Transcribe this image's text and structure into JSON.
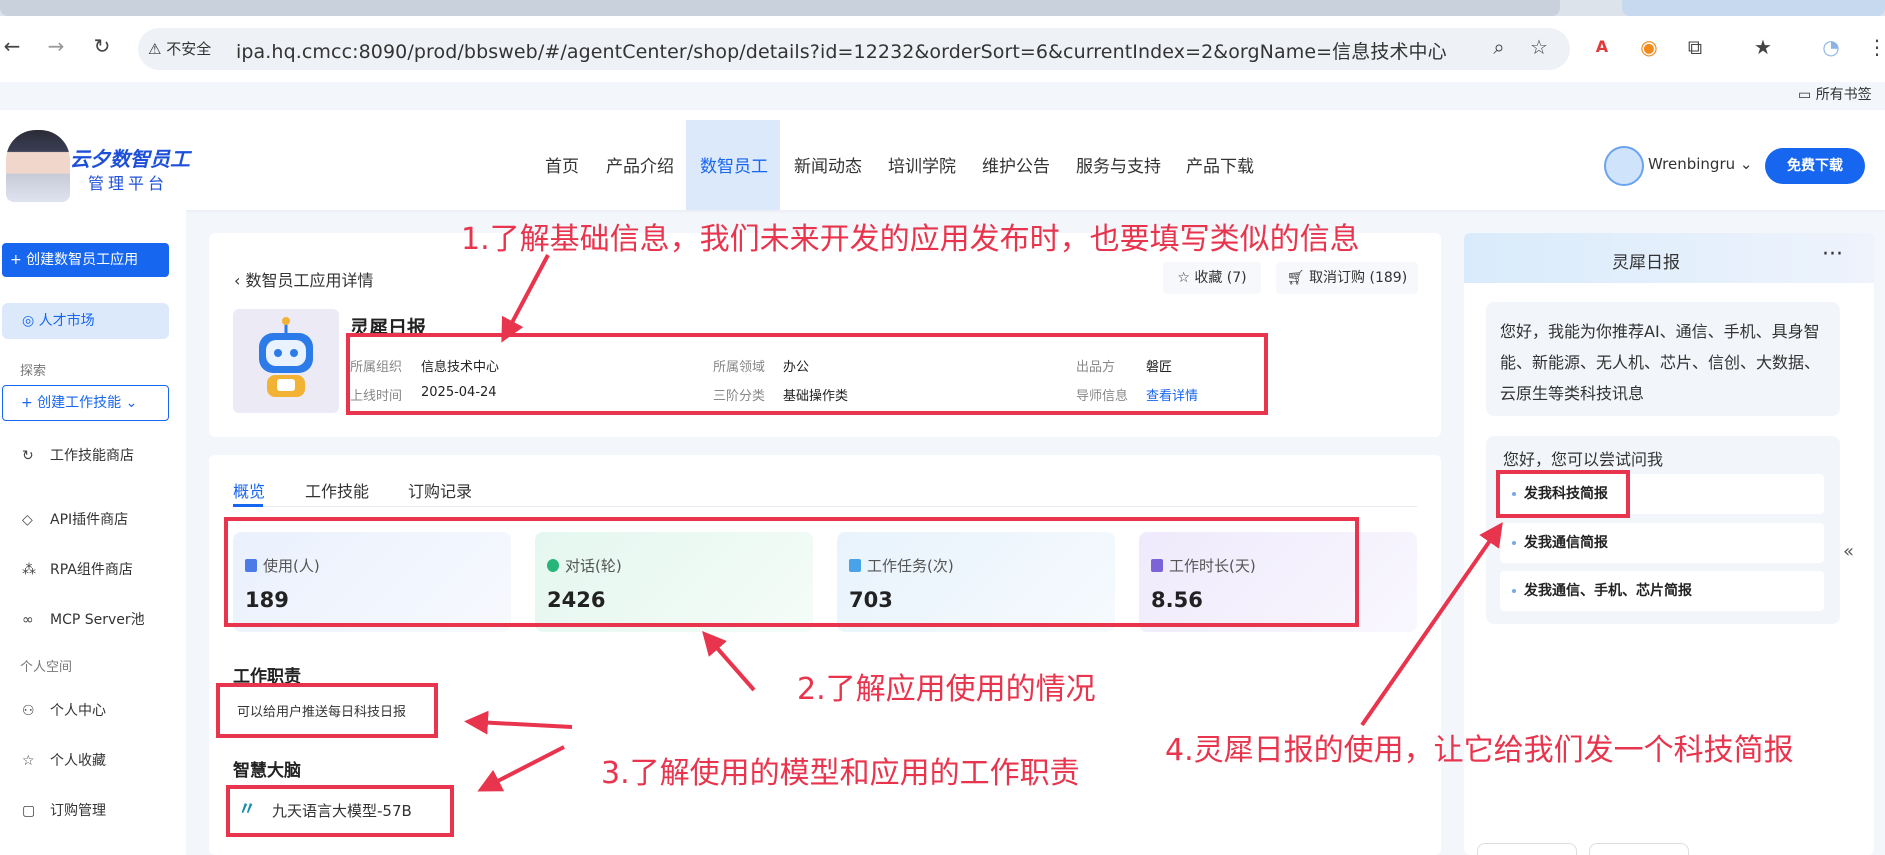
{
  "browser": {
    "insecure_label": "不安全",
    "url": "ipa.hq.cmcc:8090/prod/bbsweb/#/agentCenter/shop/details?id=12232&orderSort=6&currentIndex=2&orgName=信息技术中心",
    "bookmarks_label": "所有书签"
  },
  "brand": {
    "title": "云夕数智员工",
    "subtitle": "管理平台"
  },
  "nav": {
    "items": [
      "首页",
      "产品介绍",
      "数智员工",
      "新闻动态",
      "培训学院",
      "维护公告",
      "服务与支持",
      "产品下载"
    ],
    "active": "数智员工"
  },
  "user": {
    "name": "Wrenbingru",
    "download_label": "免费下载"
  },
  "sidebar": {
    "create_app": "+ 创建数智员工应用",
    "talent_market": "人才市场",
    "explore_label": "探索",
    "create_skill": "+ 创建工作技能",
    "items": [
      "工作技能商店",
      "API插件商店",
      "RPA组件商店",
      "MCP Server池"
    ],
    "personal_label": "个人空间",
    "personal_items": [
      "个人中心",
      "个人收藏",
      "订购管理"
    ]
  },
  "detail": {
    "back_title": "数智员工应用详情",
    "fav_label": "收藏 (7)",
    "unsub_label": "取消订购 (189)",
    "app_name": "灵犀日报",
    "meta": {
      "org_label": "所属组织",
      "org": "信息技术中心",
      "online_label": "上线时间",
      "online": "2025-04-24",
      "domain_label": "所属领域",
      "domain": "办公",
      "cat_label": "三阶分类",
      "cat": "基础操作类",
      "maker_label": "出品方",
      "maker": "磐匠",
      "mentor_label": "导师信息",
      "mentor_link": "查看详情"
    }
  },
  "tabs": [
    "概览",
    "工作技能",
    "订购记录"
  ],
  "stats": [
    {
      "label": "使用(人)",
      "value": "189",
      "color": "#4b7be6"
    },
    {
      "label": "对话(轮)",
      "value": "2426",
      "color": "#27b57a"
    },
    {
      "label": "工作任务(次)",
      "value": "703",
      "color": "#4aa3e8"
    },
    {
      "label": "工作时长(天)",
      "value": "8.56",
      "color": "#7d63d8"
    }
  ],
  "duty": {
    "title": "工作职责",
    "text": "可以给用户推送每日科技日报"
  },
  "brain": {
    "title": "智慧大脑",
    "model": "九天语言大模型-57B"
  },
  "chat": {
    "title": "灵犀日报",
    "more": "···",
    "greeting": "您好，我能为你推荐AI、通信、手机、具身智能、新能源、无人机、芯片、信创、大数据、云原生等类科技讯息",
    "try_title": "您好，您可以尝试问我",
    "suggestions": [
      "发我科技简报",
      "发我通信简报",
      "发我通信、手机、芯片简报"
    ]
  },
  "annotations": {
    "note1": "1.了解基础信息，我们未来开发的应用发布时，也要填写类似的信息",
    "note2": "2.了解应用使用的情况",
    "note3": "3.了解使用的模型和应用的工作职责",
    "note4": "4.灵犀日报的使用，让它给我们发一个科技简报",
    "color": "#e8344c"
  }
}
